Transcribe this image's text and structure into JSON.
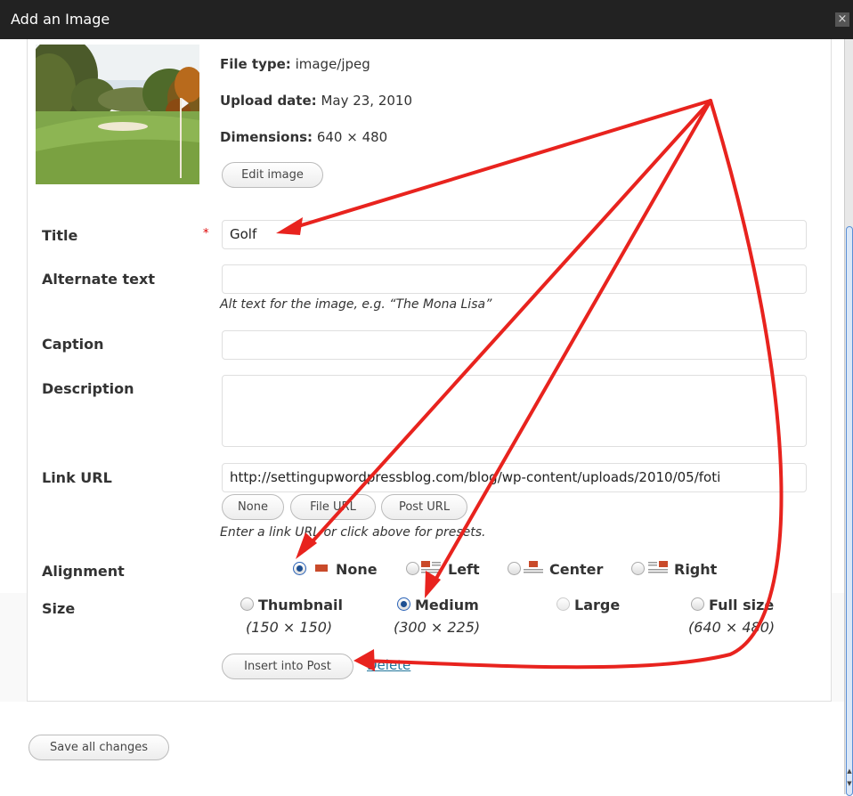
{
  "dialog": {
    "title": "Add an Image",
    "close_glyph": "×"
  },
  "meta": {
    "file_type_label": "File type:",
    "file_type_value": "image/jpeg",
    "upload_date_label": "Upload date:",
    "upload_date_value": "May 23, 2010",
    "dimensions_label": "Dimensions:",
    "dimensions_value": "640 × 480",
    "edit_image_button": "Edit image"
  },
  "fields": {
    "title_label": "Title",
    "required_mark": "*",
    "title_value": "Golf",
    "alt_label": "Alternate text",
    "alt_value": "",
    "alt_help": "Alt text for the image, e.g. “The Mona Lisa”",
    "caption_label": "Caption",
    "caption_value": "",
    "description_label": "Description",
    "description_value": "",
    "link_url_label": "Link URL",
    "link_url_value": "http://settingupwordpressblog.com/blog/wp-content/uploads/2010/05/foti",
    "link_buttons": {
      "none": "None",
      "file_url": "File URL",
      "post_url": "Post URL"
    },
    "link_help": "Enter a link URL or click above for presets."
  },
  "alignment": {
    "label": "Alignment",
    "selected": "None",
    "options": [
      {
        "label": "None"
      },
      {
        "label": "Left"
      },
      {
        "label": "Center"
      },
      {
        "label": "Right"
      }
    ]
  },
  "size": {
    "label": "Size",
    "selected": "Medium",
    "options": [
      {
        "label": "Thumbnail",
        "dims": "(150 × 150)"
      },
      {
        "label": "Medium",
        "dims": "(300 × 225)"
      },
      {
        "label": "Large",
        "dims": ""
      },
      {
        "label": "Full size",
        "dims": "(640 × 480)"
      }
    ]
  },
  "actions": {
    "insert_button": "Insert into Post",
    "delete_link": "Delete",
    "save_all_button": "Save all changes"
  },
  "colors": {
    "annotation_arrow": "#e8231e",
    "titlebar": "#222222",
    "link": "#21759b"
  },
  "icons": {
    "close": "close-icon",
    "align": "align-icon",
    "scroll": "scroll-arrow-icon"
  }
}
